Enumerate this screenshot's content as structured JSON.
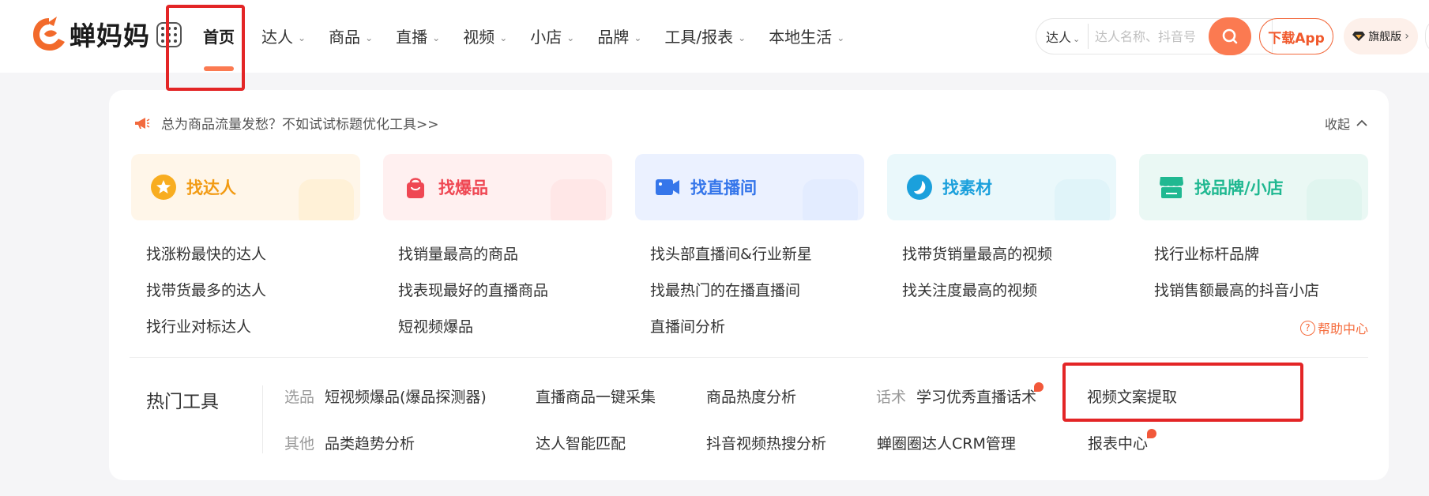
{
  "brand": {
    "name": "蝉妈妈",
    "accent": "#fb7a51",
    "highlight_color": "#e32526"
  },
  "nav": {
    "items": [
      {
        "label": "首页",
        "active": true,
        "dropdown": false
      },
      {
        "label": "达人",
        "dropdown": true
      },
      {
        "label": "商品",
        "dropdown": true
      },
      {
        "label": "直播",
        "dropdown": true
      },
      {
        "label": "视频",
        "dropdown": true
      },
      {
        "label": "小店",
        "dropdown": true
      },
      {
        "label": "品牌",
        "dropdown": true
      },
      {
        "label": "工具/报表",
        "dropdown": true
      },
      {
        "label": "本地生活",
        "dropdown": true
      }
    ],
    "icons": {
      "grid": "grid-menu-icon",
      "chevron": "chevron-down-icon"
    }
  },
  "search": {
    "type_label": "达人",
    "placeholder": "达人名称、抖音号",
    "button_icon": "search-icon"
  },
  "header_buttons": {
    "download": "下载App",
    "flagship": "旗舰版",
    "flagship_icon": "diamond-icon"
  },
  "panel": {
    "notice": "总为商品流量发愁？不如试试标题优化工具>>",
    "notice_icon": "megaphone-icon",
    "collapse_label": "收起",
    "help_label": "帮助中心",
    "cards": [
      {
        "title": "找达人",
        "icon": "star-icon",
        "color": "#f29b14"
      },
      {
        "title": "找爆品",
        "icon": "shopping-bag-icon",
        "color": "#ef4753"
      },
      {
        "title": "找直播间",
        "icon": "video-camera-icon",
        "color": "#3576ea"
      },
      {
        "title": "找素材",
        "icon": "moon-icon",
        "color": "#1ba0dc"
      },
      {
        "title": "找品牌/小店",
        "icon": "store-icon",
        "color": "#20b891"
      }
    ],
    "links": [
      [
        "找涨粉最快的达人",
        "找带货最多的达人",
        "找行业对标达人"
      ],
      [
        "找销量最高的商品",
        "找表现最好的直播商品",
        "短视频爆品"
      ],
      [
        "找头部直播间&行业新星",
        "找最热门的在播直播间",
        "直播间分析"
      ],
      [
        "找带货销量最高的视频",
        "找关注度最高的视频"
      ],
      [
        "找行业标杆品牌",
        "找销售额最高的抖音小店"
      ]
    ],
    "hot_tools": {
      "title": "热门工具",
      "row1": {
        "category_1": "选品",
        "t1": "短视频爆品(爆品探测器)",
        "t2": "直播商品一键采集",
        "t3": "商品热度分析",
        "category_2": "话术",
        "t4": "学习优秀直播话术",
        "t5": "视频文案提取"
      },
      "row2": {
        "category_1": "其他",
        "t1": "品类趋势分析",
        "t2": "达人智能匹配",
        "t3": "抖音视频热搜分析",
        "t4": "蝉圈圈达人CRM管理",
        "t5": "报表中心"
      }
    }
  }
}
